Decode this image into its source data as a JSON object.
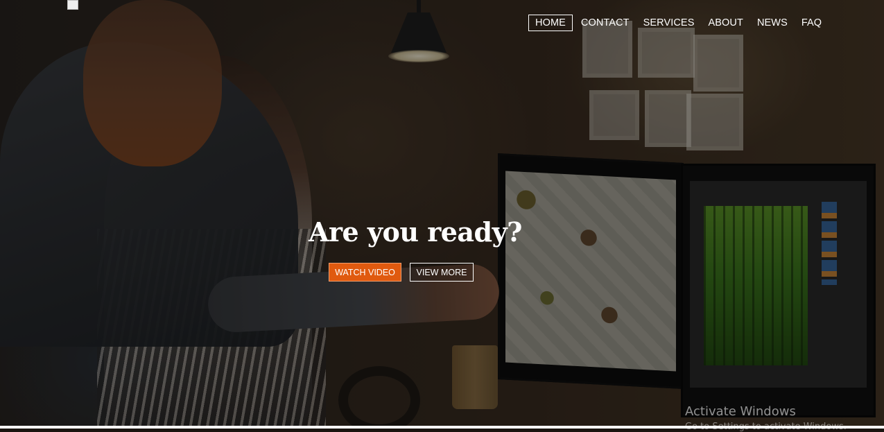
{
  "nav": {
    "items": [
      {
        "label": "HOME",
        "active": true
      },
      {
        "label": "CONTACT"
      },
      {
        "label": "SERVICES"
      },
      {
        "label": "ABOUT"
      },
      {
        "label": "NEWS"
      },
      {
        "label": "FAQ"
      }
    ]
  },
  "hero": {
    "headline": "Are you ready?",
    "watch_button": "WATCH VIDEO",
    "view_button": "VIEW MORE"
  },
  "watermark": {
    "title": "Activate Windows",
    "subtitle": "Go to Settings to activate Windows."
  },
  "colors": {
    "accent": "#e05a0f",
    "text": "#ffffff"
  },
  "icons": {
    "logo": "broken-image-icon"
  }
}
